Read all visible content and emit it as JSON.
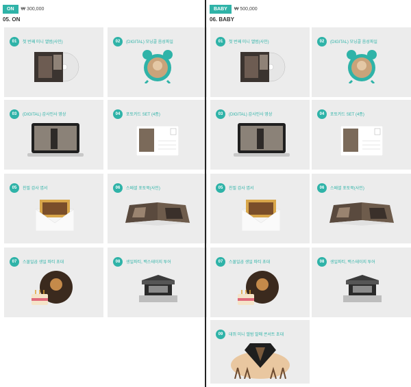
{
  "left": {
    "tier_label": "ON",
    "price": "₩ 300,000",
    "section_title": "05. ON",
    "cards": [
      {
        "num": "01",
        "label": "첫 번째 미니 앨범(사인)"
      },
      {
        "num": "02",
        "label": "(DIGITAL) 모닝콜 음성파일"
      },
      {
        "num": "03",
        "label": "(DIGITAL) 감사인사 영상"
      },
      {
        "num": "04",
        "label": "포토카드 SET (4종)"
      },
      {
        "num": "05",
        "label": "친필 감사 엽서"
      },
      {
        "num": "06",
        "label": "스페셜 포토북(사인)"
      },
      {
        "num": "07",
        "label": "스물일곱 생일 파티 초대"
      },
      {
        "num": "08",
        "label": "생일파티, 백스테이지 투어"
      }
    ]
  },
  "right": {
    "tier_label": "BABY",
    "price": "₩ 500,000",
    "section_title": "06. BABY",
    "cards": [
      {
        "num": "01",
        "label": "첫 번째 미니 앨범(사인)"
      },
      {
        "num": "02",
        "label": "(DIGITAL) 모닝콜 음성파일"
      },
      {
        "num": "03",
        "label": "(DIGITAL) 감사인사 영상"
      },
      {
        "num": "04",
        "label": "포토카드 SET (4종)"
      },
      {
        "num": "05",
        "label": "친필 감사 엽서"
      },
      {
        "num": "06",
        "label": "스페셜 포토북(사인)"
      },
      {
        "num": "07",
        "label": "스물일곱 생일 파티 초대"
      },
      {
        "num": "08",
        "label": "생일파티, 백스테이지 투어"
      },
      {
        "num": "09",
        "label": "데뷔 미니 앨범 발매 콘서트 초대"
      }
    ]
  },
  "colors": {
    "accent": "#2fb3a8"
  }
}
